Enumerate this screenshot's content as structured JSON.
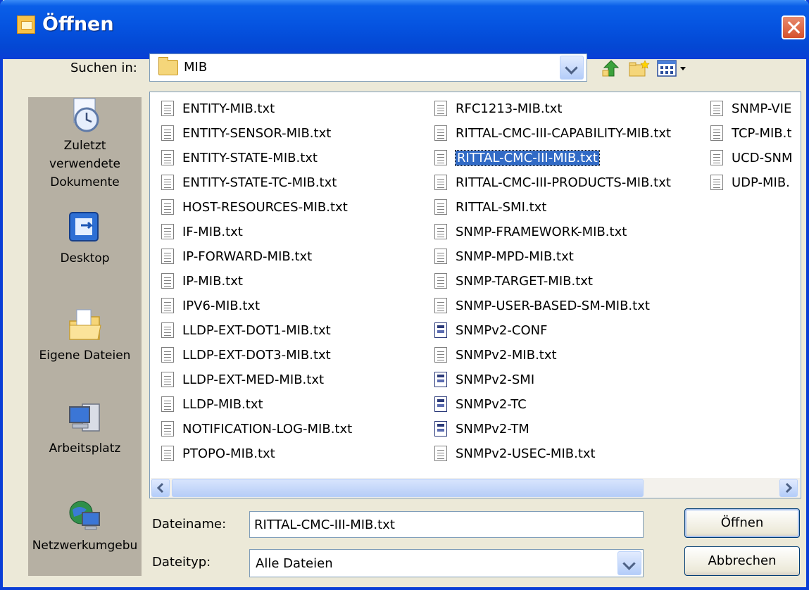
{
  "title": "Öffnen",
  "look_in": {
    "label": "Suchen in:",
    "value": "MIB"
  },
  "places": [
    {
      "label": "Zuletzt\nverwendete\nDokumente",
      "icon": "recent-documents-icon"
    },
    {
      "label": "Desktop",
      "icon": "desktop-icon"
    },
    {
      "label": "Eigene Dateien",
      "icon": "my-documents-icon"
    },
    {
      "label": "Arbeitsplatz",
      "icon": "my-computer-icon"
    },
    {
      "label": "Netzwerkumgebu",
      "icon": "network-places-icon"
    }
  ],
  "files": {
    "col1": [
      "ENTITY-MIB.txt",
      "ENTITY-SENSOR-MIB.txt",
      "ENTITY-STATE-MIB.txt",
      "ENTITY-STATE-TC-MIB.txt",
      "HOST-RESOURCES-MIB.txt",
      "IF-MIB.txt",
      "IP-FORWARD-MIB.txt",
      "IP-MIB.txt",
      "IPV6-MIB.txt",
      "LLDP-EXT-DOT1-MIB.txt",
      "LLDP-EXT-DOT3-MIB.txt",
      "LLDP-EXT-MED-MIB.txt",
      "LLDP-MIB.txt",
      "NOTIFICATION-LOG-MIB.txt",
      "PTOPO-MIB.txt"
    ],
    "col2": [
      "RFC1213-MIB.txt",
      "RITTAL-CMC-III-CAPABILITY-MIB.txt",
      "RITTAL-CMC-III-MIB.txt",
      "RITTAL-CMC-III-PRODUCTS-MIB.txt",
      "RITTAL-SMI.txt",
      "SNMP-FRAMEWORK-MIB.txt",
      "SNMP-MPD-MIB.txt",
      "SNMP-TARGET-MIB.txt",
      "SNMP-USER-BASED-SM-MIB.txt",
      "SNMPv2-CONF",
      "SNMPv2-MIB.txt",
      "SNMPv2-SMI",
      "SNMPv2-TC",
      "SNMPv2-TM",
      "SNMPv2-USEC-MIB.txt"
    ],
    "col3": [
      "SNMP-VIE",
      "TCP-MIB.t",
      "UCD-SNM",
      "UDP-MIB."
    ]
  },
  "selected_file": "RITTAL-CMC-III-MIB.txt",
  "filename": {
    "label": "Dateiname:",
    "value": "RITTAL-CMC-III-MIB.txt"
  },
  "filetype": {
    "label": "Dateityp:",
    "value": "Alle Dateien"
  },
  "buttons": {
    "open": "Öffnen",
    "cancel": "Abbrechen"
  },
  "colors": {
    "titlebar": "#0553e0",
    "selection": "#316ac5",
    "dialog_bg": "#ece9d8"
  }
}
